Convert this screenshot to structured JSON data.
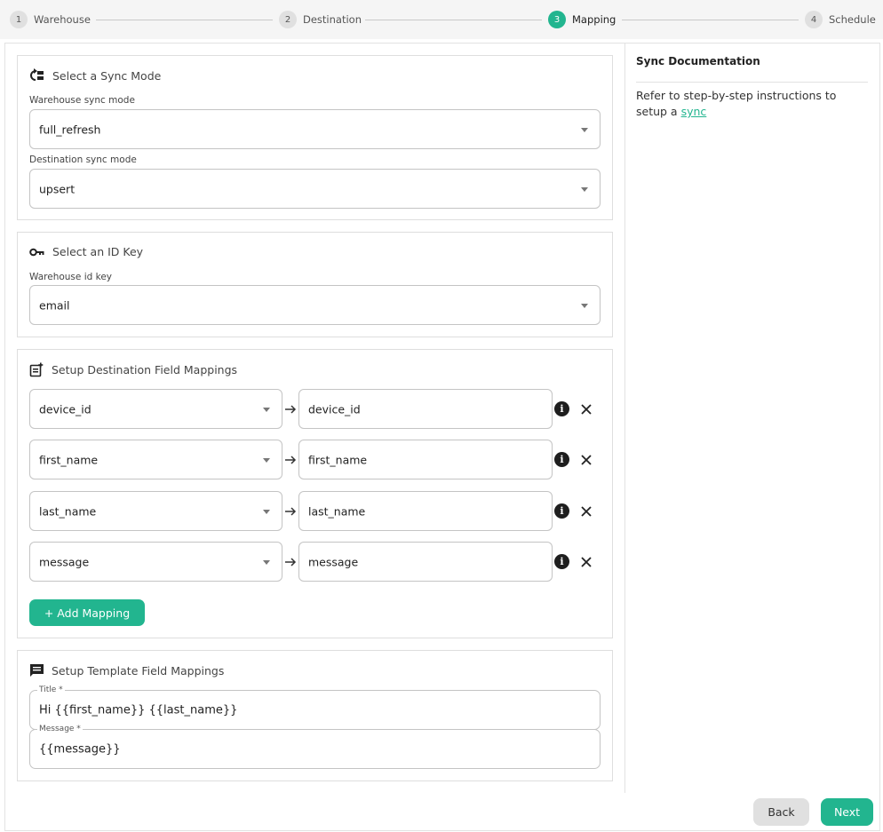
{
  "stepper": {
    "steps": [
      {
        "number": "1",
        "label": "Warehouse"
      },
      {
        "number": "2",
        "label": "Destination"
      },
      {
        "number": "3",
        "label": "Mapping"
      },
      {
        "number": "4",
        "label": "Schedule"
      }
    ],
    "active_step": 3
  },
  "sync_mode": {
    "title": "Select a Sync Mode",
    "warehouse_label": "Warehouse sync mode",
    "warehouse_value": "full_refresh",
    "destination_label": "Destination sync mode",
    "destination_value": "upsert"
  },
  "id_key": {
    "title": "Select an ID Key",
    "label": "Warehouse id key",
    "value": "email"
  },
  "field_mappings": {
    "title": "Setup Destination Field Mappings",
    "rows": [
      {
        "source": "device_id",
        "destination": "device_id"
      },
      {
        "source": "first_name",
        "destination": "first_name"
      },
      {
        "source": "last_name",
        "destination": "last_name"
      },
      {
        "source": "message",
        "destination": "message"
      }
    ],
    "add_label": "+ Add Mapping"
  },
  "template_mappings": {
    "title": "Setup Template Field Mappings",
    "title_label": "Title *",
    "title_value": "Hi {{first_name}} {{last_name}}",
    "message_label": "Message *",
    "message_value": "{{message}}"
  },
  "docs": {
    "title": "Sync Documentation",
    "text": "Refer to step-by-step instructions to setup a ",
    "link_text": "sync"
  },
  "footer": {
    "back_label": "Back",
    "next_label": "Next"
  },
  "colors": {
    "accent": "#22b58f",
    "step_inactive": "#e0e0e0"
  }
}
